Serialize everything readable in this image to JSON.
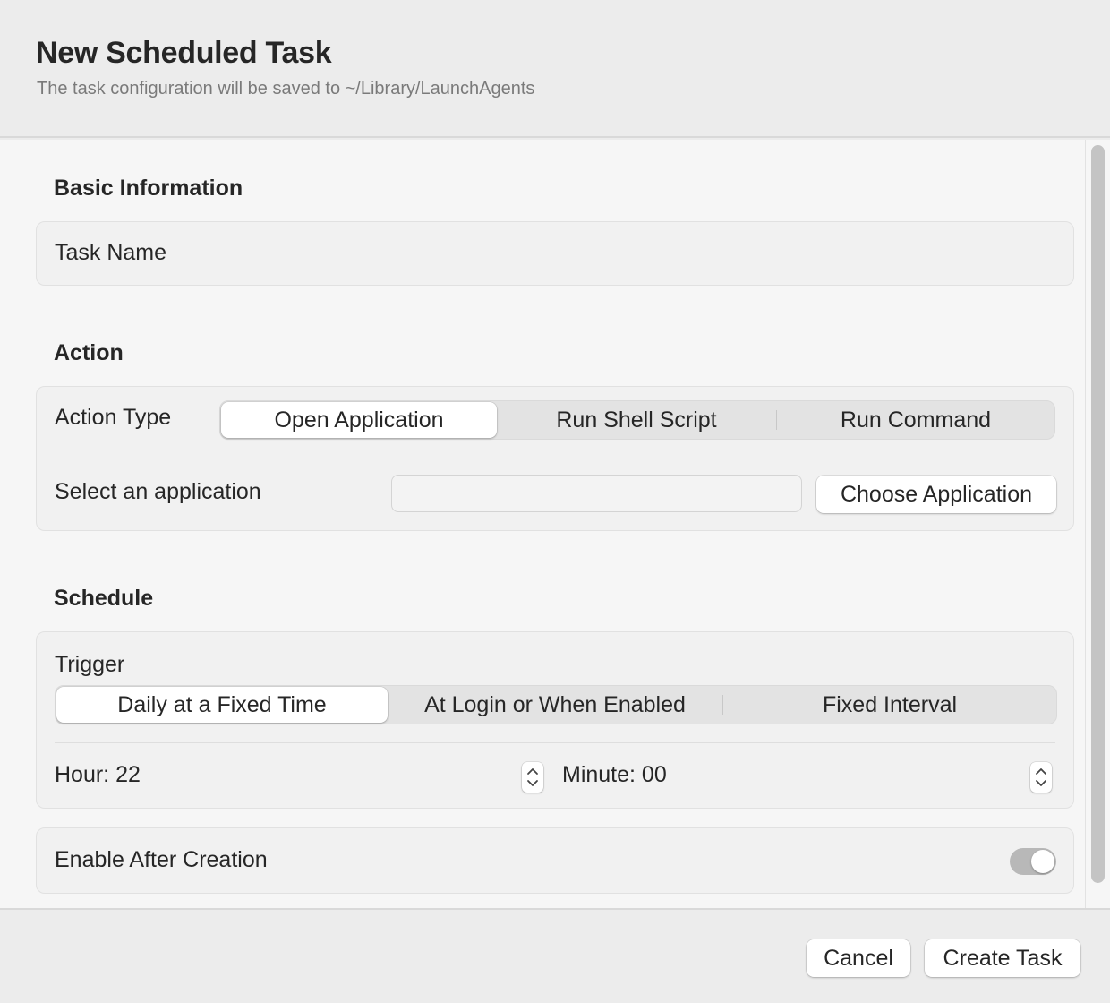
{
  "window": {
    "title": "New Scheduled Task",
    "subtitle": "The task configuration will be saved to ~/Library/LaunchAgents"
  },
  "basic_info": {
    "section_title": "Basic Information",
    "task_name_label": "Task Name",
    "task_name_value": ""
  },
  "action": {
    "section_title": "Action",
    "type_label": "Action Type",
    "types": [
      "Open Application",
      "Run Shell Script",
      "Run Command"
    ],
    "selected_type": "Open Application",
    "app_label": "Select an application",
    "app_value": "",
    "choose_button": "Choose Application"
  },
  "schedule": {
    "section_title": "Schedule",
    "trigger_label": "Trigger",
    "triggers": [
      "Daily at a Fixed Time",
      "At Login or When Enabled",
      "Fixed Interval"
    ],
    "selected_trigger": "Daily at a Fixed Time",
    "hour_text": "Hour: 22",
    "minute_text": "Minute: 00"
  },
  "enable": {
    "label": "Enable After Creation",
    "on": false
  },
  "footer": {
    "cancel": "Cancel",
    "create": "Create Task"
  }
}
